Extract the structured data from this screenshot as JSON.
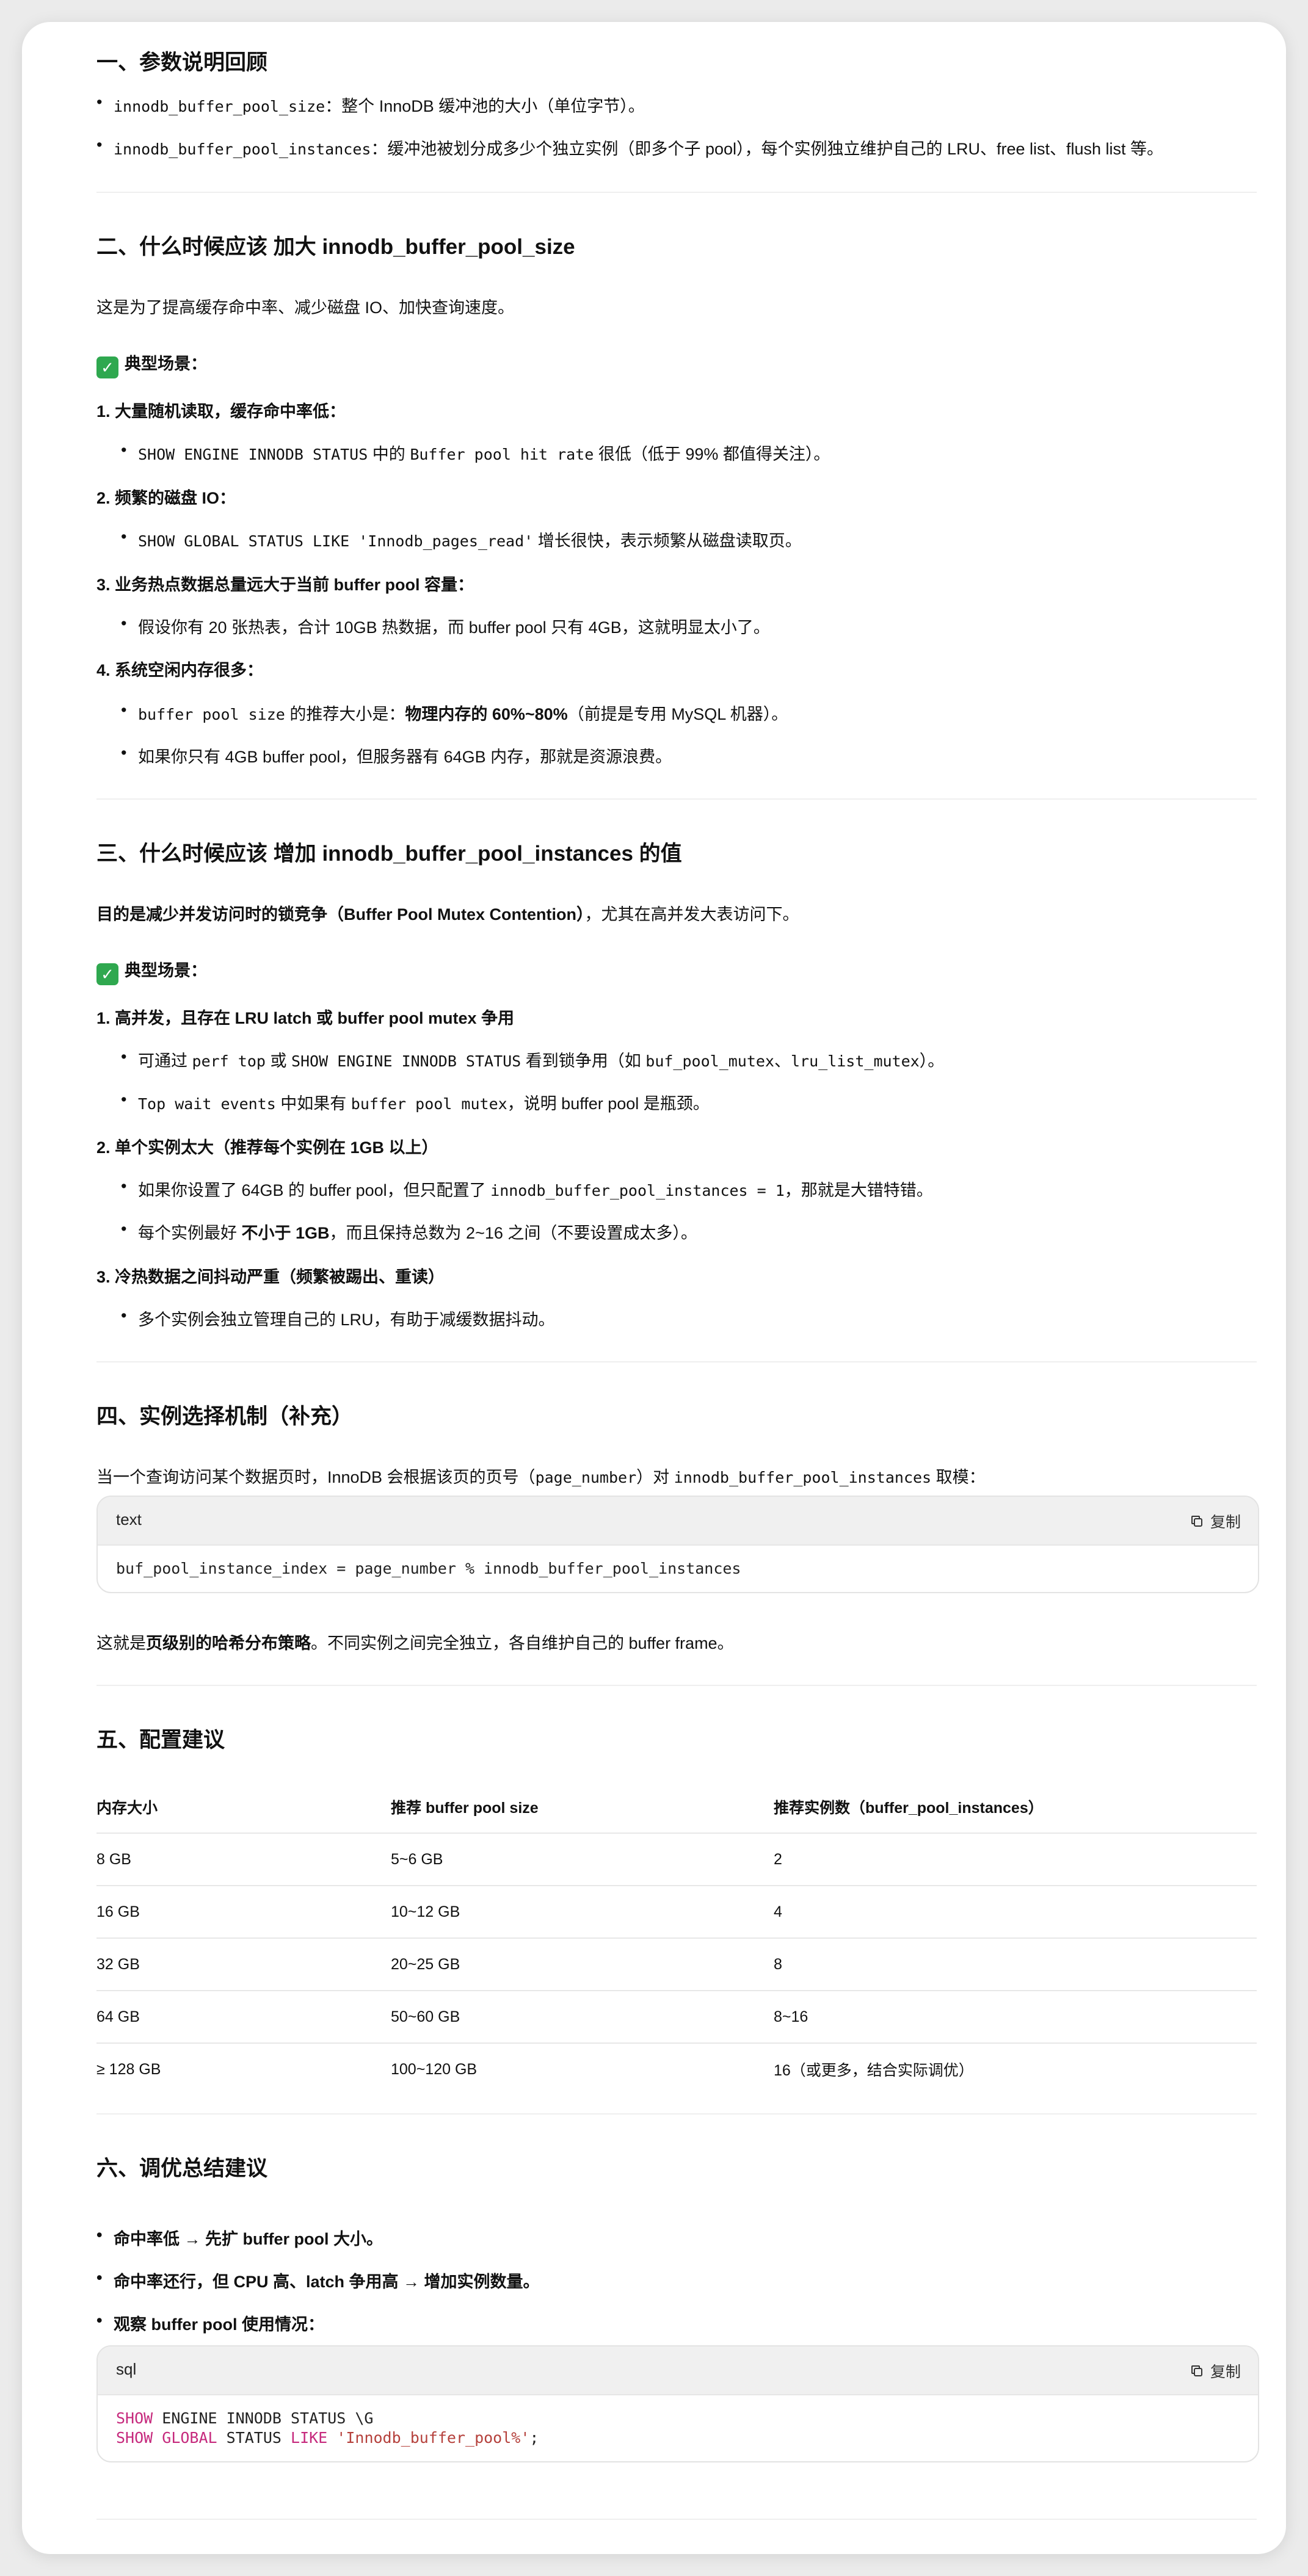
{
  "s1": {
    "heading": "一、参数说明回顾",
    "b1_code": "innodb_buffer_pool_size",
    "b1_text": "：整个 InnoDB 缓冲池的大小（单位字节）。",
    "b2_code": "innodb_buffer_pool_instances",
    "b2_text": "：缓冲池被划分成多少个独立实例（即多个子 pool），每个实例独立维护自己的 LRU、free list、flush list 等。"
  },
  "s2": {
    "heading": "二、什么时候应该 加大 innodb_buffer_pool_size",
    "intro": "这是为了提高缓存命中率、减少磁盘 IO、加快查询速度。",
    "scenes": "典型场景：",
    "i1": "1.  大量随机读取，缓存命中率低：",
    "i1_s1_code1": "SHOW ENGINE INNODB STATUS",
    "i1_s1_t1": " 中的 ",
    "i1_s1_code2": "Buffer pool hit rate",
    "i1_s1_t2": " 很低（低于 99% 都值得关注）。",
    "i2": "2.  频繁的磁盘 IO：",
    "i2_s1_code": "SHOW GLOBAL STATUS LIKE 'Innodb_pages_read'",
    "i2_s1_text": " 增长很快，表示频繁从磁盘读取页。",
    "i3": "3.  业务热点数据总量远大于当前 buffer pool 容量：",
    "i3_s1": "假设你有 20 张热表，合计 10GB 热数据，而 buffer pool 只有 4GB，这就明显太小了。",
    "i4": "4.  系统空闲内存很多：",
    "i4_s1_code": "buffer pool size",
    "i4_s1_t1": " 的推荐大小是：",
    "i4_s1_bold": "物理内存的 60%~80%",
    "i4_s1_t2": "（前提是专用 MySQL 机器）。",
    "i4_s2": "如果你只有 4GB buffer pool，但服务器有 64GB 内存，那就是资源浪费。"
  },
  "s3": {
    "heading": "三、什么时候应该 增加 innodb_buffer_pool_instances 的值",
    "intro_bold": "目的是减少并发访问时的锁竞争（Buffer Pool Mutex Contention）",
    "intro_text": "，尤其在高并发大表访问下。",
    "scenes": "典型场景：",
    "i1": "1.  高并发，且存在 LRU latch 或 buffer pool mutex 争用",
    "i1_s1_t1": "可通过 ",
    "i1_s1_c1": "perf top",
    "i1_s1_t2": " 或 ",
    "i1_s1_c2": "SHOW ENGINE INNODB STATUS",
    "i1_s1_t3": " 看到锁争用（如 ",
    "i1_s1_c3": "buf_pool_mutex",
    "i1_s1_t4": "、",
    "i1_s1_c4": "lru_list_mutex",
    "i1_s1_t5": "）。",
    "i1_s2_c1": "Top wait events",
    "i1_s2_t1": " 中如果有 ",
    "i1_s2_c2": "buffer pool mutex",
    "i1_s2_t2": "，说明 buffer pool 是瓶颈。",
    "i2": "2.  单个实例太大（推荐每个实例在 1GB 以上）",
    "i2_s1_t1": "如果你设置了 64GB 的 buffer pool，但只配置了 ",
    "i2_s1_c1": "innodb_buffer_pool_instances = 1",
    "i2_s1_t2": "，那就是大错特错。",
    "i2_s2_t1": "每个实例最好 ",
    "i2_s2_b": "不小于 1GB",
    "i2_s2_t2": "，而且保持总数为 2~16 之间（不要设置成太多）。",
    "i3": "3.  冷热数据之间抖动严重（频繁被踢出、重读）",
    "i3_s1": "多个实例会独立管理自己的 LRU，有助于减缓数据抖动。"
  },
  "s4": {
    "heading": "四、实例选择机制（补充）",
    "intro_t1": "当一个查询访问某个数据页时，InnoDB 会根据该页的页号（",
    "intro_c1": "page_number",
    "intro_t2": "）对 ",
    "intro_c2": "innodb_buffer_pool_instances",
    "intro_t3": " 取模：",
    "code_lang": "text",
    "copy_label": "复制",
    "code_line": "buf_pool_instance_index = page_number % innodb_buffer_pool_instances",
    "after_t1": "这就是",
    "after_b": "页级别的哈希分布策略",
    "after_t2": "。不同实例之间完全独立，各自维护自己的 buffer frame。"
  },
  "s5": {
    "heading": "五、配置建议",
    "headers": [
      "内存大小",
      "推荐 buffer pool size",
      "推荐实例数（buffer_pool_instances）"
    ],
    "rows": [
      [
        "8 GB",
        "5~6 GB",
        "2"
      ],
      [
        "16 GB",
        "10~12 GB",
        "4"
      ],
      [
        "32 GB",
        "20~25 GB",
        "8"
      ],
      [
        "64 GB",
        "50~60 GB",
        "8~16"
      ],
      [
        "≥ 128 GB",
        "100~120 GB",
        "16（或更多，结合实际调优）"
      ]
    ]
  },
  "s6": {
    "heading": "六、调优总结建议",
    "b1": "命中率低 → 先扩 buffer pool 大小。",
    "b2": "命中率还行，但 CPU 高、latch 争用高 → 增加实例数量。",
    "b3": "观察 buffer pool 使用情况：",
    "code_lang": "sql",
    "copy_label": "复制",
    "l1_kw": "SHOW",
    "l1_rest": " ENGINE INNODB STATUS \\G",
    "l2_kw1": "SHOW",
    "l2_kw2": "GLOBAL",
    "l2_mid": " STATUS ",
    "l2_kw3": "LIKE",
    "l2_str": "'Innodb_buffer_pool%'",
    "l2_end": ";"
  }
}
